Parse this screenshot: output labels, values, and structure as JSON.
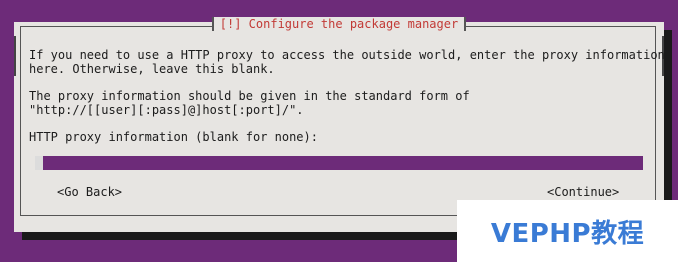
{
  "dialog": {
    "title": "[!] Configure the package manager",
    "paragraph1_line1": "If you need to use a HTTP proxy to access the outside world, enter the proxy information",
    "paragraph1_line2": "here. Otherwise, leave this blank.",
    "paragraph2_line1": "The proxy information should be given in the standard form of",
    "paragraph2_line2": "\"http://[[user][:pass]@]host[:port]/\".",
    "field_label": "HTTP proxy information (blank for none):",
    "field_value": ""
  },
  "buttons": {
    "back_label": "<Go Back>",
    "continue_label": "<Continue>"
  },
  "watermark": {
    "text": "VEPHP教程"
  },
  "colors": {
    "background": "#6d2b79",
    "dialog_bg": "#e7e5e2",
    "title_red": "#c23a36",
    "watermark_blue": "#3a7bd5"
  }
}
